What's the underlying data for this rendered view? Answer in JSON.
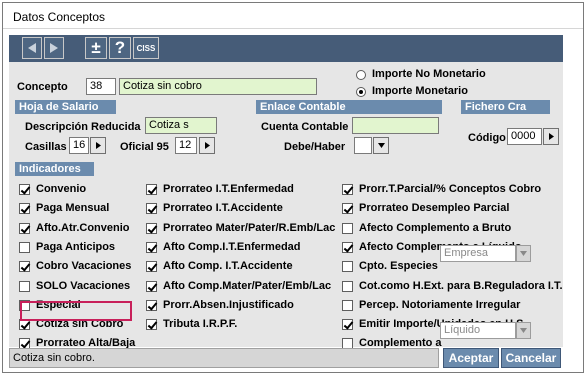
{
  "window": {
    "title": "Datos Conceptos"
  },
  "toolbar": {
    "add_label": "±",
    "help_label": "?",
    "ciss_label": "CISS"
  },
  "concepto": {
    "label": "Concepto",
    "code": "38",
    "name": "Cotiza sin cobro"
  },
  "importe": {
    "no_monetario": "Importe No Monetario",
    "monetario": "Importe Monetario",
    "selected": "monetario"
  },
  "hoja_salario": {
    "title": "Hoja de Salario",
    "descripcion_label": "Descripción Reducida",
    "descripcion_value": "Cotiza s",
    "casillas_label": "Casillas",
    "casillas_value": "16",
    "oficial_label": "Oficial 95",
    "oficial_value": "12"
  },
  "enlace_contable": {
    "title": "Enlace Contable",
    "cuenta_label": "Cuenta Contable",
    "cuenta_value": "",
    "debe_haber_label": "Debe/Haber",
    "debe_haber_value": ""
  },
  "fichero_cra": {
    "title": "Fichero Cra",
    "codigo_label": "Código",
    "codigo_value": "0000"
  },
  "indicadores": {
    "title": "Indicadores",
    "col1": [
      {
        "label": "Convenio",
        "checked": true
      },
      {
        "label": "Paga Mensual",
        "checked": true
      },
      {
        "label": "Afto.Atr.Convenio",
        "checked": true
      },
      {
        "label": "Paga Anticipos",
        "checked": false
      },
      {
        "label": "Cobro Vacaciones",
        "checked": true
      },
      {
        "label": "SOLO Vacaciones",
        "checked": false
      },
      {
        "label": "Especial",
        "checked": false
      },
      {
        "label": "Cotiza sin Cobro",
        "checked": true
      },
      {
        "label": "Prorrateo Alta/Baja",
        "checked": true
      }
    ],
    "col2": [
      {
        "label": "Prorrateo I.T.Enfermedad",
        "checked": true
      },
      {
        "label": "Prorrateo I.T.Accidente",
        "checked": true
      },
      {
        "label": "Prorrateo Mater/Pater/R.Emb/Lac",
        "checked": true
      },
      {
        "label": "Afto Comp.I.T.Enfermedad",
        "checked": true
      },
      {
        "label": "Afto Comp. I.T.Accidente",
        "checked": true
      },
      {
        "label": "Afto Comp.Mater/Pater/Emb/Lac",
        "checked": true
      },
      {
        "label": "Prorr.Absen.Injustificado",
        "checked": true
      },
      {
        "label": "Tributa I.R.P.F.",
        "checked": true
      }
    ],
    "col3": [
      {
        "label": "Prorr.T.Parcial/% Conceptos Cobro",
        "checked": true
      },
      {
        "label": "Prorrateo Desempleo Parcial",
        "checked": true
      },
      {
        "label": "Afecto Complemento a Bruto",
        "checked": false
      },
      {
        "label": "Afecto Complemento a Líquido",
        "checked": true
      },
      {
        "label": "Cpto. Especies",
        "checked": false
      },
      {
        "label": "Cot.como H.Ext. para B.Reguladora I.T.",
        "checked": false
      },
      {
        "label": "Percep. Notoriamente Irregular",
        "checked": false
      },
      {
        "label": "Emitir Importe/Unidades en H.S.",
        "checked": true
      },
      {
        "label": "Complemento a",
        "checked": false
      }
    ],
    "especies_value": "Empresa",
    "complemento_value": "Líquido"
  },
  "status": {
    "text": "Cotiza sin cobro."
  },
  "buttons": {
    "aceptar": "Aceptar",
    "cancelar": "Cancelar"
  },
  "colors": {
    "accent": "#6b8bad",
    "toolbar": "#465c78",
    "field_green": "#e2f5cf",
    "highlight": "#c8205a"
  }
}
